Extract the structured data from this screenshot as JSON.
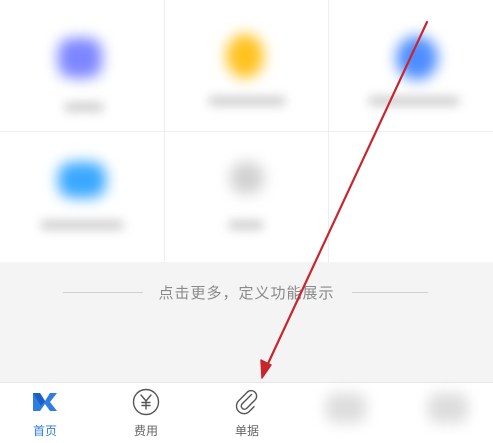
{
  "hint": {
    "text": "点击更多，定义功能展示"
  },
  "grid": {
    "tiles": [
      {
        "icon": "blurred-app-icon",
        "color": "#7d86ff"
      },
      {
        "icon": "blurred-app-icon",
        "color": "#ffc21f"
      },
      {
        "icon": "blurred-app-icon",
        "color": "#4f8dff"
      },
      {
        "icon": "blurred-app-icon",
        "color": "#3aa8ff"
      },
      {
        "icon": "blurred-app-icon",
        "color": "#d2d2d2"
      }
    ]
  },
  "tabbar": {
    "tabs": [
      {
        "label": "首页",
        "icon": "home-logo-icon",
        "active": true
      },
      {
        "label": "费用",
        "icon": "yen-circle-icon",
        "active": false
      },
      {
        "label": "单据",
        "icon": "paperclip-icon",
        "active": false
      }
    ]
  },
  "colors": {
    "accent": "#2f7de1",
    "annotation": "#c8262c",
    "tab_text": "#666666",
    "hint_text": "#8a8a8a"
  }
}
